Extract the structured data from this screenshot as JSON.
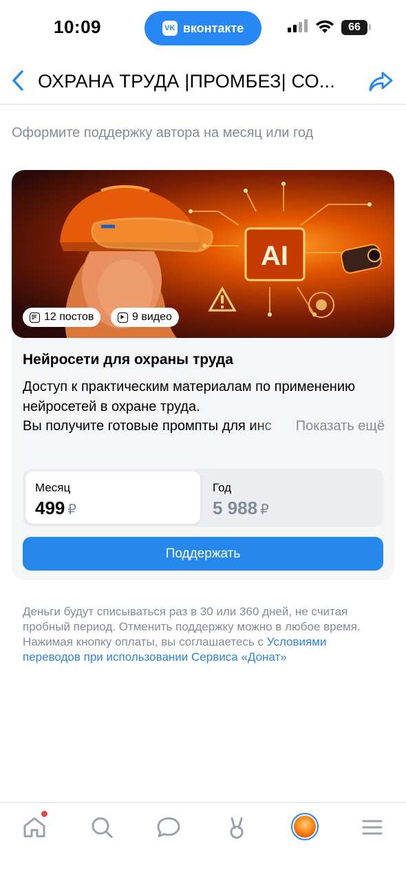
{
  "status_bar": {
    "time": "10:09",
    "app_pill": "вконтакте",
    "app_logo": "VK",
    "battery": "66"
  },
  "header": {
    "title": "ОХРАНА ТРУДА |ПРОМБЕЗ| СО...",
    "back_icon": "chevron-left-icon",
    "share_icon": "share-icon"
  },
  "subtitle": "Оформите поддержку автора на месяц или год",
  "card": {
    "cover_image_label": "AI",
    "chips": {
      "posts": "12 постов",
      "videos": "9 видео"
    },
    "title": "Нейросети для охраны труда",
    "description": "Доступ к практическим материалам по применению нейросетей в охране труда.",
    "description_cut": "Вы получите готовые промпты для инс",
    "show_more": "Показать ещё",
    "plans": {
      "month": {
        "label": "Месяц",
        "price": "499",
        "currency": "₽",
        "selected": true
      },
      "year": {
        "label": "Год",
        "price": "5 988",
        "currency": "₽",
        "selected": false
      }
    },
    "support_button": "Поддержать"
  },
  "disclaimer": {
    "text": "Деньги будут списываться раз в 30 или 360 дней, не считая пробный период. Отменить поддержку можно в любое время. Нажимая кнопку оплаты, вы соглашаетесь с ",
    "link": "Условиями переводов при использовании Сервиса «Донат»"
  },
  "tab_bar": {
    "items": [
      "home-icon",
      "search-icon",
      "messages-icon",
      "clips-icon",
      "avatar",
      "menu-icon"
    ],
    "home_notification": true
  },
  "colors": {
    "accent": "#2688eb",
    "secondary_text": "#818c99",
    "card_bg": "#f5f6f8",
    "notification": "#e64646"
  }
}
